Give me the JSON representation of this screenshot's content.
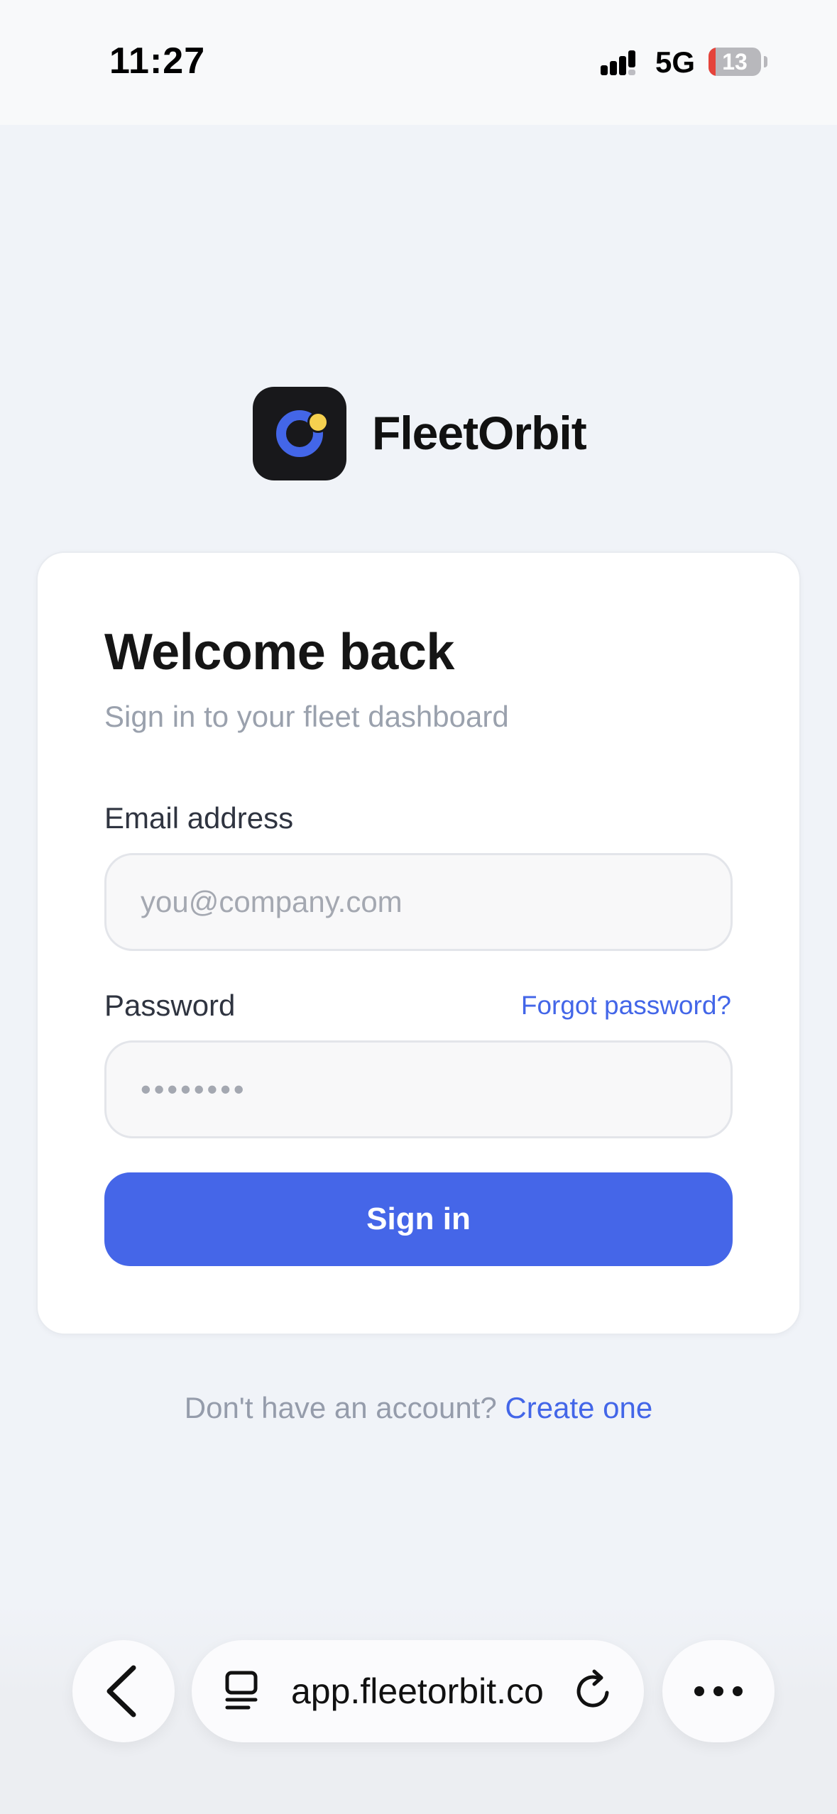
{
  "status_bar": {
    "time": "11:27",
    "network": "5G",
    "battery_level": "13",
    "battery_fraction": 0.13
  },
  "brand": {
    "name": "FleetOrbit",
    "logo_colors": {
      "background": "#18181b",
      "ring": "#4366e8",
      "dot": "#f5d04f"
    }
  },
  "login": {
    "title": "Welcome back",
    "subtitle": "Sign in to your fleet dashboard",
    "email_label": "Email address",
    "email_placeholder": "you@company.com",
    "email_value": "",
    "password_label": "Password",
    "forgot_label": "Forgot password?",
    "password_placeholder": "••••••••",
    "password_value": "",
    "submit_label": "Sign in"
  },
  "signup": {
    "prompt": "Don't have an account?",
    "link_label": "Create one"
  },
  "browser": {
    "url": "app.fleetorbit.co",
    "icons": [
      "chevron-left-icon",
      "tabs-icon",
      "reload-icon",
      "more-icon"
    ]
  },
  "colors": {
    "accent": "#4366e8",
    "page_background": "#f0f3f8",
    "card_background": "#ffffff"
  }
}
